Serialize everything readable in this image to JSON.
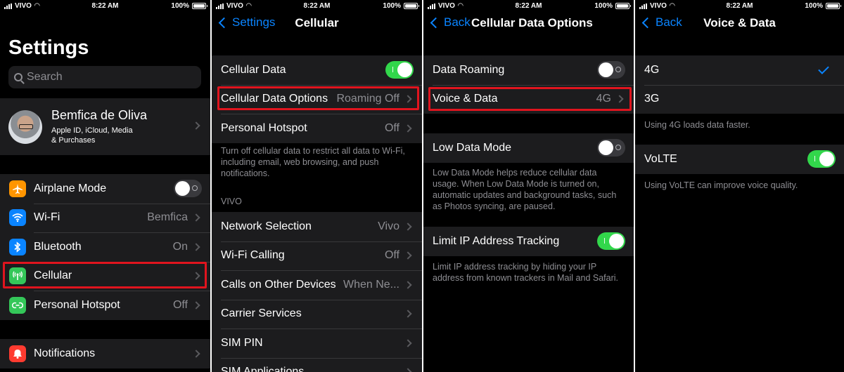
{
  "status": {
    "carrier": "VIVO",
    "time": "8:22 AM",
    "battery": "100%"
  },
  "colors": {
    "accent": "#0a84ff",
    "toggle_on": "#32d74b",
    "highlight": "#e0141e"
  },
  "screen1": {
    "title": "Settings",
    "search_placeholder": "Search",
    "profile": {
      "name": "Bemfica de Oliva",
      "subtitle_line1": "Apple ID, iCloud, Media",
      "subtitle_line2": "& Purchases"
    },
    "items": [
      {
        "label": "Airplane Mode",
        "icon": "airplane-icon",
        "color": "#ff9500",
        "toggle": "off"
      },
      {
        "label": "Wi-Fi",
        "value": "Bemfica",
        "icon": "wifi-icon",
        "color": "#0a84ff"
      },
      {
        "label": "Bluetooth",
        "value": "On",
        "icon": "bluetooth-icon",
        "color": "#0a84ff"
      },
      {
        "label": "Cellular",
        "value": "",
        "icon": "antenna-icon",
        "color": "#34c759"
      },
      {
        "label": "Personal Hotspot",
        "value": "Off",
        "icon": "hotspot-icon",
        "color": "#34c759"
      }
    ],
    "notifications": {
      "label": "Notifications",
      "icon": "bell-icon",
      "color": "#ff3b30"
    }
  },
  "screen2": {
    "back": "Settings",
    "title": "Cellular",
    "group1": [
      {
        "label": "Cellular Data",
        "toggle": "on"
      },
      {
        "label": "Cellular Data Options",
        "value": "Roaming Off"
      },
      {
        "label": "Personal Hotspot",
        "value": "Off"
      }
    ],
    "footer": "Turn off cellular data to restrict all data to Wi-Fi, including email, web browsing, and push notifications.",
    "section_header": "VIVO",
    "group2": [
      {
        "label": "Network Selection",
        "value": "Vivo"
      },
      {
        "label": "Wi-Fi Calling",
        "value": "Off"
      },
      {
        "label": "Calls on Other Devices",
        "value": "When Ne..."
      },
      {
        "label": "Carrier Services",
        "value": ""
      },
      {
        "label": "SIM PIN",
        "value": ""
      },
      {
        "label": "SIM Applications",
        "value": ""
      }
    ]
  },
  "screen3": {
    "back": "Back",
    "title": "Cellular Data Options",
    "data_roaming": {
      "label": "Data Roaming",
      "toggle": "off"
    },
    "voice_data": {
      "label": "Voice & Data",
      "value": "4G"
    },
    "low_data": {
      "label": "Low Data Mode",
      "toggle": "off"
    },
    "low_data_footer": "Low Data Mode helps reduce cellular data usage. When Low Data Mode is turned on, automatic updates and background tasks, such as Photos syncing, are paused.",
    "limit_ip": {
      "label": "Limit IP Address Tracking",
      "toggle": "on"
    },
    "limit_ip_footer": "Limit IP address tracking by hiding your IP address from known trackers in Mail and Safari."
  },
  "screen4": {
    "back": "Back",
    "title": "Voice & Data",
    "options": [
      {
        "label": "4G",
        "selected": true
      },
      {
        "label": "3G",
        "selected": false
      }
    ],
    "options_footer": "Using 4G loads data faster.",
    "volte": {
      "label": "VoLTE",
      "toggle": "on"
    },
    "volte_footer": "Using VoLTE can improve voice quality."
  }
}
